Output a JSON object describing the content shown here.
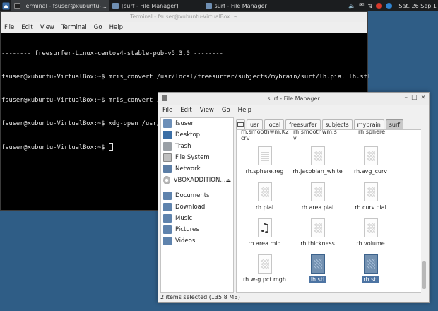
{
  "panel": {
    "tasks": [
      {
        "label": "Terminal - fsuser@xubuntu-..."
      },
      {
        "label": "[surf - File Manager]"
      },
      {
        "label": "surf - File Manager"
      }
    ],
    "clock": "Sat, 26 Sep  1"
  },
  "terminal": {
    "title": "Terminal - fsuser@xubuntu-VirtualBox: ~",
    "menu": [
      "File",
      "Edit",
      "View",
      "Terminal",
      "Go",
      "Help"
    ],
    "lines": [
      "-------- freesurfer-Linux-centos4-stable-pub-v5.3.0 --------",
      "fsuser@xubuntu-VirtualBox:~$ mris_convert /usr/local/freesurfer/subjects/mybrain/surf/lh.pial lh.stl",
      "fsuser@xubuntu-VirtualBox:~$ mris_convert /usr/local/freesurfer/subjects/mybrain/surf/lh.pial lh.stl",
      "fsuser@xubuntu-VirtualBox:~$ xdg-open /usr/local/freesurfer/subjects/mybrain/surf/",
      "fsuser@xubuntu-VirtualBox:~$ "
    ]
  },
  "fm": {
    "title": "surf - File Manager",
    "menu": [
      "File",
      "Edit",
      "View",
      "Go",
      "Help"
    ],
    "path": [
      "usr",
      "local",
      "freesurfer",
      "subjects",
      "mybrain",
      "surf"
    ],
    "sidebar": {
      "places": [
        "fsuser",
        "Desktop",
        "Trash",
        "File System",
        "Network",
        "VBOXADDITION..."
      ],
      "bookmarks": [
        "Documents",
        "Download",
        "Music",
        "Pictures",
        "Videos"
      ]
    },
    "cut_labels": [
      "rh.smoothwm.K2",
      "crv",
      "rh.smoothwm.s",
      "v",
      "rh.sphere"
    ],
    "files": [
      "rh.sphere.reg",
      "rh.jacobian_white",
      "rh.avg_curv",
      "rh.pial",
      "rh.area.pial",
      "rh.curv.pial",
      "rh.area.mid",
      "rh.thickness",
      "rh.volume",
      "rh.w-g.pct.mgh",
      "lh.stl",
      "rh.stl"
    ],
    "status": "2 items selected (135.8 MB)"
  },
  "colors": {
    "desktop": "#2f5d86",
    "selection": "#4d74a3"
  }
}
